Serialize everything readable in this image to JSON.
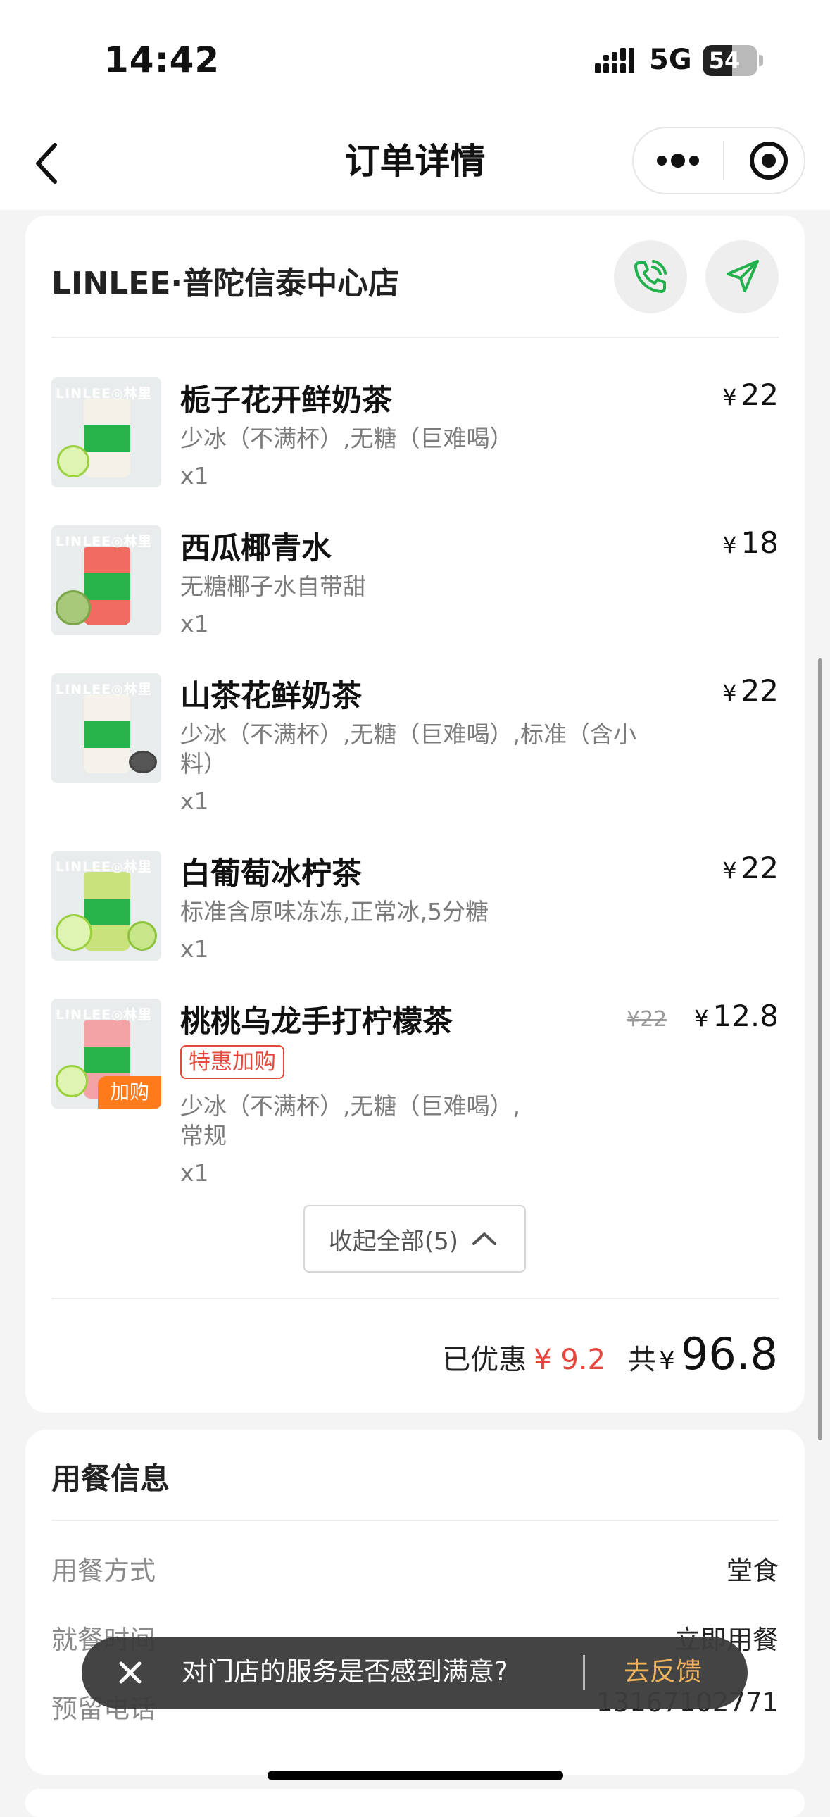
{
  "status": {
    "time": "14:42",
    "network": "5G",
    "battery": "54",
    "battery_level": 0.54
  },
  "nav": {
    "title": "订单详情"
  },
  "store": {
    "name": "LINLEE·普陀信泰中心店"
  },
  "items": [
    {
      "name": "栀子花开鲜奶茶",
      "options": "少冰（不满杯）,无糖（巨难喝）",
      "qty": "x1",
      "price": "22",
      "yen": "¥",
      "thumb_brand": "LINLEE◎林里",
      "cup_color": "#f3f1e8"
    },
    {
      "name": "西瓜椰青水",
      "options": "无糖椰子水自带甜",
      "qty": "x1",
      "price": "18",
      "yen": "¥",
      "thumb_brand": "LINLEE◎林里",
      "cup_color": "#f06b60"
    },
    {
      "name": "山茶花鲜奶茶",
      "options": "少冰（不满杯）,无糖（巨难喝）,标准（含小料）",
      "qty": "x1",
      "price": "22",
      "yen": "¥",
      "thumb_brand": "LINLEE◎林里",
      "cup_color": "#f4f2ea"
    },
    {
      "name": "白葡萄冰柠茶",
      "options": "标准含原味冻冻,正常冰,5分糖",
      "qty": "x1",
      "price": "22",
      "yen": "¥",
      "thumb_brand": "LINLEE◎林里",
      "cup_color": "#c9e27a"
    },
    {
      "name": "桃桃乌龙手打柠檬茶",
      "options": "少冰（不满杯）,无糖（巨难喝）,\n常规",
      "qty": "x1",
      "price": "12.8",
      "original_price": "¥22",
      "yen": "¥",
      "badge": "特惠加购",
      "thumb_tag": "加购",
      "thumb_brand": "LINLEE◎林里",
      "cup_color": "#f3a3a6"
    }
  ],
  "collapse_button": {
    "label": "收起全部(5)"
  },
  "totals": {
    "discount_label": "已优惠",
    "discount_value": "¥ 9.2",
    "total_label": "共",
    "yen": "¥",
    "total_value": "96.8"
  },
  "dining": {
    "title": "用餐信息",
    "rows": [
      {
        "label": "用餐方式",
        "value": "堂食"
      },
      {
        "label": "就餐时间",
        "value": "立即用餐"
      },
      {
        "label": "预留电话",
        "value": "13167102771"
      }
    ]
  },
  "toast": {
    "text": "对门店的服务是否感到满意?",
    "action": "去反馈"
  },
  "colors": {
    "accent_green": "#23b14d",
    "discount_red": "#e8453c",
    "toast_link": "#f0b35c"
  }
}
